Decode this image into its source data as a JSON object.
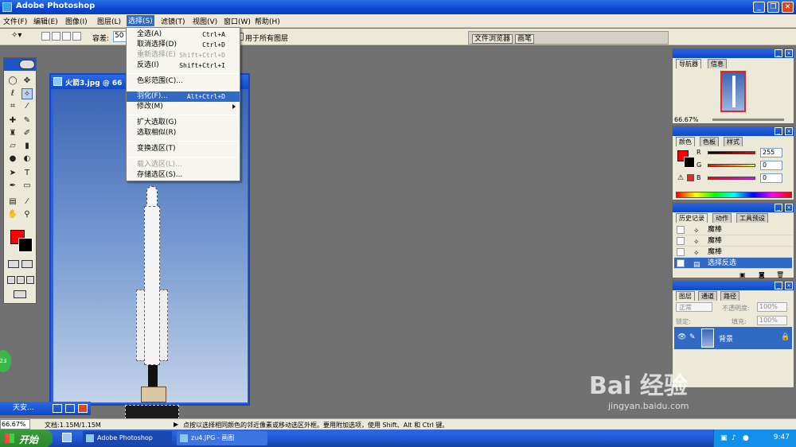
{
  "app": {
    "title": "Adobe Photoshop"
  },
  "window_controls": {
    "minimize": "_",
    "restore": "❐",
    "close": "✕"
  },
  "menubar": [
    {
      "label": "文件(F)"
    },
    {
      "label": "编辑(E)"
    },
    {
      "label": "图像(I)"
    },
    {
      "label": "图层(L)"
    },
    {
      "label": "选择(S)"
    },
    {
      "label": "滤镜(T)"
    },
    {
      "label": "视图(V)"
    },
    {
      "label": "窗口(W)"
    },
    {
      "label": "帮助(H)"
    }
  ],
  "options_bar": {
    "tolerance_label": "容差:",
    "tolerance_value": "50",
    "all_layers_label": "用于所有图层"
  },
  "tab_well": {
    "file_browser": "文件浏览器",
    "brushes": "画笔"
  },
  "select_menu": {
    "items": [
      {
        "label": "全选(A)",
        "shortcut": "Ctrl+A"
      },
      {
        "label": "取消选择(D)",
        "shortcut": "Ctrl+D"
      },
      {
        "label": "重新选择(E)",
        "shortcut": "Shift+Ctrl+D"
      },
      {
        "label": "反选(I)",
        "shortcut": "Shift+Ctrl+I"
      },
      {
        "label": "色彩范围(C)..."
      },
      {
        "label": "羽化(F)...",
        "shortcut": "Alt+Ctrl+D"
      },
      {
        "label": "修改(M)"
      },
      {
        "label": "扩大选取(G)"
      },
      {
        "label": "选取相似(R)"
      },
      {
        "label": "变换选区(T)"
      },
      {
        "label": "载入选区(L)..."
      },
      {
        "label": "存储选区(S)..."
      }
    ]
  },
  "document": {
    "title": "火箭3.jpg @ 66"
  },
  "navigator_panel": {
    "tabs": [
      "导航器",
      "信息"
    ],
    "zoom": "66.67%"
  },
  "color_panel": {
    "tabs": [
      "颜色",
      "色板",
      "样式"
    ],
    "channels": [
      {
        "label": "R",
        "value": "255"
      },
      {
        "label": "G",
        "value": "0"
      },
      {
        "label": "B",
        "value": "0"
      }
    ]
  },
  "history_panel": {
    "tabs": [
      "历史记录",
      "动作",
      "工具预设"
    ],
    "items": [
      {
        "label": "魔棒"
      },
      {
        "label": "魔棒"
      },
      {
        "label": "魔棒"
      },
      {
        "label": "选择反选"
      }
    ]
  },
  "layers_panel": {
    "tabs": [
      "图层",
      "通道",
      "路径"
    ],
    "blend_mode": "正常",
    "opacity_label": "不透明度:",
    "opacity_value": "100%",
    "lock_label": "锁定:",
    "fill_label": "填充:",
    "fill_value": "100%",
    "layer_name": "背景"
  },
  "status_bar": {
    "zoom": "66.67%",
    "doc_info": "文档:1.15M/1.15M",
    "hint": "点按以选择相同颜色的邻近像素或移动选区外框。要用附加选项，使用 Shift、Alt 和 Ctrl 键。"
  },
  "minimized_doc": {
    "label": "天安..."
  },
  "green_bubble": "23",
  "taskbar": {
    "start": "开始",
    "items": [
      {
        "label": "Adobe Photoshop"
      },
      {
        "label": "zu4.JPG - 画图"
      }
    ],
    "clock": "9:47"
  },
  "watermark": {
    "logo": "Bai 经验",
    "url": "jingyan.baidu.com"
  }
}
